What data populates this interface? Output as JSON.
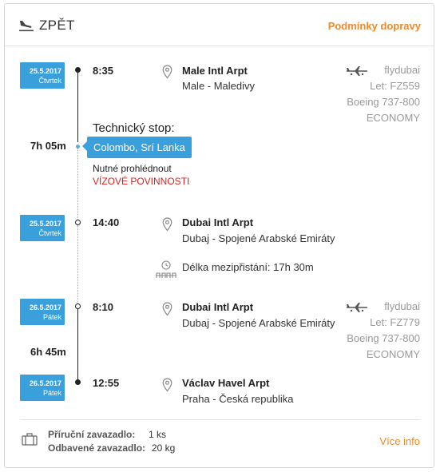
{
  "header": {
    "title": "ZPĚT",
    "terms_link": "Podmínky dopravy"
  },
  "segments": [
    {
      "departure": {
        "date": "25.5.2017",
        "day": "Čtvrtek",
        "time": "8:35",
        "airport": "Male Intl Arpt",
        "location": "Male - Maledivy"
      },
      "airline": {
        "name": "flydubai",
        "flight": "Let: FZ559",
        "aircraft": "Boeing 737-800",
        "class": "ECONOMY"
      },
      "duration": "7h 05m",
      "technical_stop": {
        "title": "Technický stop:",
        "city": "Colombo, Srí Lanka",
        "inspection": "Nutné prohlédnout",
        "visa": "VÍZOVÉ POVINNOSTI"
      },
      "arrival": {
        "date": "25.5.2017",
        "day": "Čtvrtek",
        "time": "14:40",
        "airport": "Dubai Intl Arpt",
        "location": "Dubaj - Spojené Arabské Emiráty"
      }
    },
    {
      "departure": {
        "date": "26.5.2017",
        "day": "Pátek",
        "time": "8:10",
        "airport": "Dubai Intl Arpt",
        "location": "Dubaj - Spojené Arabské Emiráty"
      },
      "airline": {
        "name": "flydubai",
        "flight": "Let: FZ779",
        "aircraft": "Boeing 737-800",
        "class": "ECONOMY"
      },
      "duration": "6h 45m",
      "arrival": {
        "date": "26.5.2017",
        "day": "Pátek",
        "time": "12:55",
        "airport": "Václav Havel Arpt",
        "location": "Praha - Česká republika"
      }
    }
  ],
  "layover": "Délka mezipřistání: 17h 30m",
  "baggage": {
    "hand_label": "Příruční zavazadlo:",
    "hand_value": "1 ks",
    "checked_label": "Odbavené zavazadlo:",
    "checked_value": "20 kg",
    "more_info": "Více info"
  },
  "colors": {
    "accent_orange": "#f0892c",
    "badge_blue": "#3aa0dc",
    "visa_red": "#e0201d"
  },
  "icons": [
    "plane-landing-icon",
    "location-pin-icon",
    "airplane-icon",
    "clock-seats-icon",
    "luggage-icon"
  ]
}
